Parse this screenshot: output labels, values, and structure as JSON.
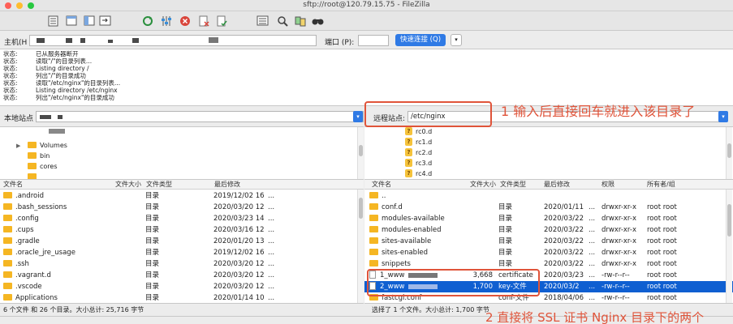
{
  "window": {
    "title": "sftp://root@120.79.15.75 - FileZilla"
  },
  "quickconnect": {
    "host_label": "主机(H",
    "port_label": "端口 (P):",
    "connect_button": "快速连接 (Q)",
    "dropdown": "▾"
  },
  "log": [
    {
      "k": "状态:",
      "v": "已从服务器断开"
    },
    {
      "k": "状态:",
      "v": "读取\"/\"的目录列表..."
    },
    {
      "k": "状态:",
      "v": "Listing directory /"
    },
    {
      "k": "状态:",
      "v": "列出\"/\"的目录成功"
    },
    {
      "k": "状态:",
      "v": "读取\"/etc/nginx\"的目录列表..."
    },
    {
      "k": "状态:",
      "v": "Listing directory /etc/nginx"
    },
    {
      "k": "状态:",
      "v": "列出\"/etc/nginx\"的目录成功"
    }
  ],
  "local": {
    "path_label": "本地站点",
    "tree": [
      "Volumes",
      "bin",
      "cores"
    ],
    "headers": [
      "文件名",
      "文件大小",
      "文件类型",
      "最后修改"
    ],
    "rows": [
      {
        "name": ".android",
        "type": "目录",
        "modified": "2019/12/02 16",
        "more": "..."
      },
      {
        "name": ".bash_sessions",
        "type": "目录",
        "modified": "2020/03/20 12",
        "more": "..."
      },
      {
        "name": ".config",
        "type": "目录",
        "modified": "2020/03/23 14",
        "more": "..."
      },
      {
        "name": ".cups",
        "type": "目录",
        "modified": "2020/03/16 12",
        "more": "..."
      },
      {
        "name": ".gradle",
        "type": "目录",
        "modified": "2020/01/20 13",
        "more": "..."
      },
      {
        "name": ".oracle_jre_usage",
        "type": "目录",
        "modified": "2019/12/02 16",
        "more": "..."
      },
      {
        "name": ".ssh",
        "type": "目录",
        "modified": "2020/03/20 12",
        "more": "..."
      },
      {
        "name": ".vagrant.d",
        "type": "目录",
        "modified": "2020/03/20 12",
        "more": "..."
      },
      {
        "name": ".vscode",
        "type": "目录",
        "modified": "2020/03/20 12",
        "more": "..."
      },
      {
        "name": "Applications",
        "type": "目录",
        "modified": "2020/01/14 10",
        "more": "..."
      }
    ],
    "status": "6 个文件 和 26 个目录。大小总计: 25,716 字节"
  },
  "remote": {
    "path_label": "远程站点:",
    "path_value": "/etc/nginx",
    "tree": [
      "rc0.d",
      "rc1.d",
      "rc2.d",
      "rc3.d",
      "rc4.d"
    ],
    "tree_icon": "?",
    "headers": [
      "文件名",
      "文件大小",
      "文件类型",
      "最后修改",
      "权限",
      "所有者/组"
    ],
    "rows": [
      {
        "name": "..",
        "size": "",
        "type": "",
        "modified": "",
        "more": "",
        "perm": "",
        "owner": ""
      },
      {
        "name": "conf.d",
        "size": "",
        "type": "目录",
        "modified": "2020/01/11",
        "more": "...",
        "perm": "drwxr-xr-x",
        "owner": "root root"
      },
      {
        "name": "modules-available",
        "size": "",
        "type": "目录",
        "modified": "2020/03/22",
        "more": "...",
        "perm": "drwxr-xr-x",
        "owner": "root root"
      },
      {
        "name": "modules-enabled",
        "size": "",
        "type": "目录",
        "modified": "2020/03/22",
        "more": "...",
        "perm": "drwxr-xr-x",
        "owner": "root root"
      },
      {
        "name": "sites-available",
        "size": "",
        "type": "目录",
        "modified": "2020/03/22",
        "more": "...",
        "perm": "drwxr-xr-x",
        "owner": "root root"
      },
      {
        "name": "sites-enabled",
        "size": "",
        "type": "目录",
        "modified": "2020/03/22",
        "more": "...",
        "perm": "drwxr-xr-x",
        "owner": "root root"
      },
      {
        "name": "snippets",
        "size": "",
        "type": "目录",
        "modified": "2020/03/22",
        "more": "...",
        "perm": "drwxr-xr-x",
        "owner": "root root"
      },
      {
        "name": "1_www",
        "size": "3,668",
        "type": "certificate",
        "modified": "2020/03/23",
        "more": "...",
        "perm": "-rw-r--r--",
        "owner": "root root"
      },
      {
        "name": "2_www",
        "size": "1,700",
        "type": "key-文件",
        "modified": "2020/03/2",
        "more": "...",
        "perm": "-rw-r--r--",
        "owner": "root root"
      },
      {
        "name": "fastcgi.conf",
        "size": "",
        "type": "conf-文件",
        "modified": "2018/04/06",
        "more": "...",
        "perm": "-rw-r--r--",
        "owner": "root root"
      }
    ],
    "selected_index": 8,
    "status": "选择了 1 个文件。大小总计: 1,700 字节"
  },
  "annotations": {
    "first": "1 输入后直接回车就进入该目录了",
    "second": "2 直接将 SSL 证书 Nginx 目录下的两个"
  },
  "colors": {
    "accent": "#2f7ae5",
    "selection": "#0f5fd1",
    "annotation": "#e0543a",
    "folder": "#f5b623"
  },
  "icons": [
    "site-manager-icon",
    "toggle-log-icon",
    "toggle-local-tree-icon",
    "toggle-remote-tree-icon",
    "refresh-icon",
    "process-queue-icon",
    "cancel-icon",
    "disconnect-icon",
    "reconnect-icon",
    "filter-icon",
    "compare-icon",
    "search-icon",
    "find-icon"
  ]
}
